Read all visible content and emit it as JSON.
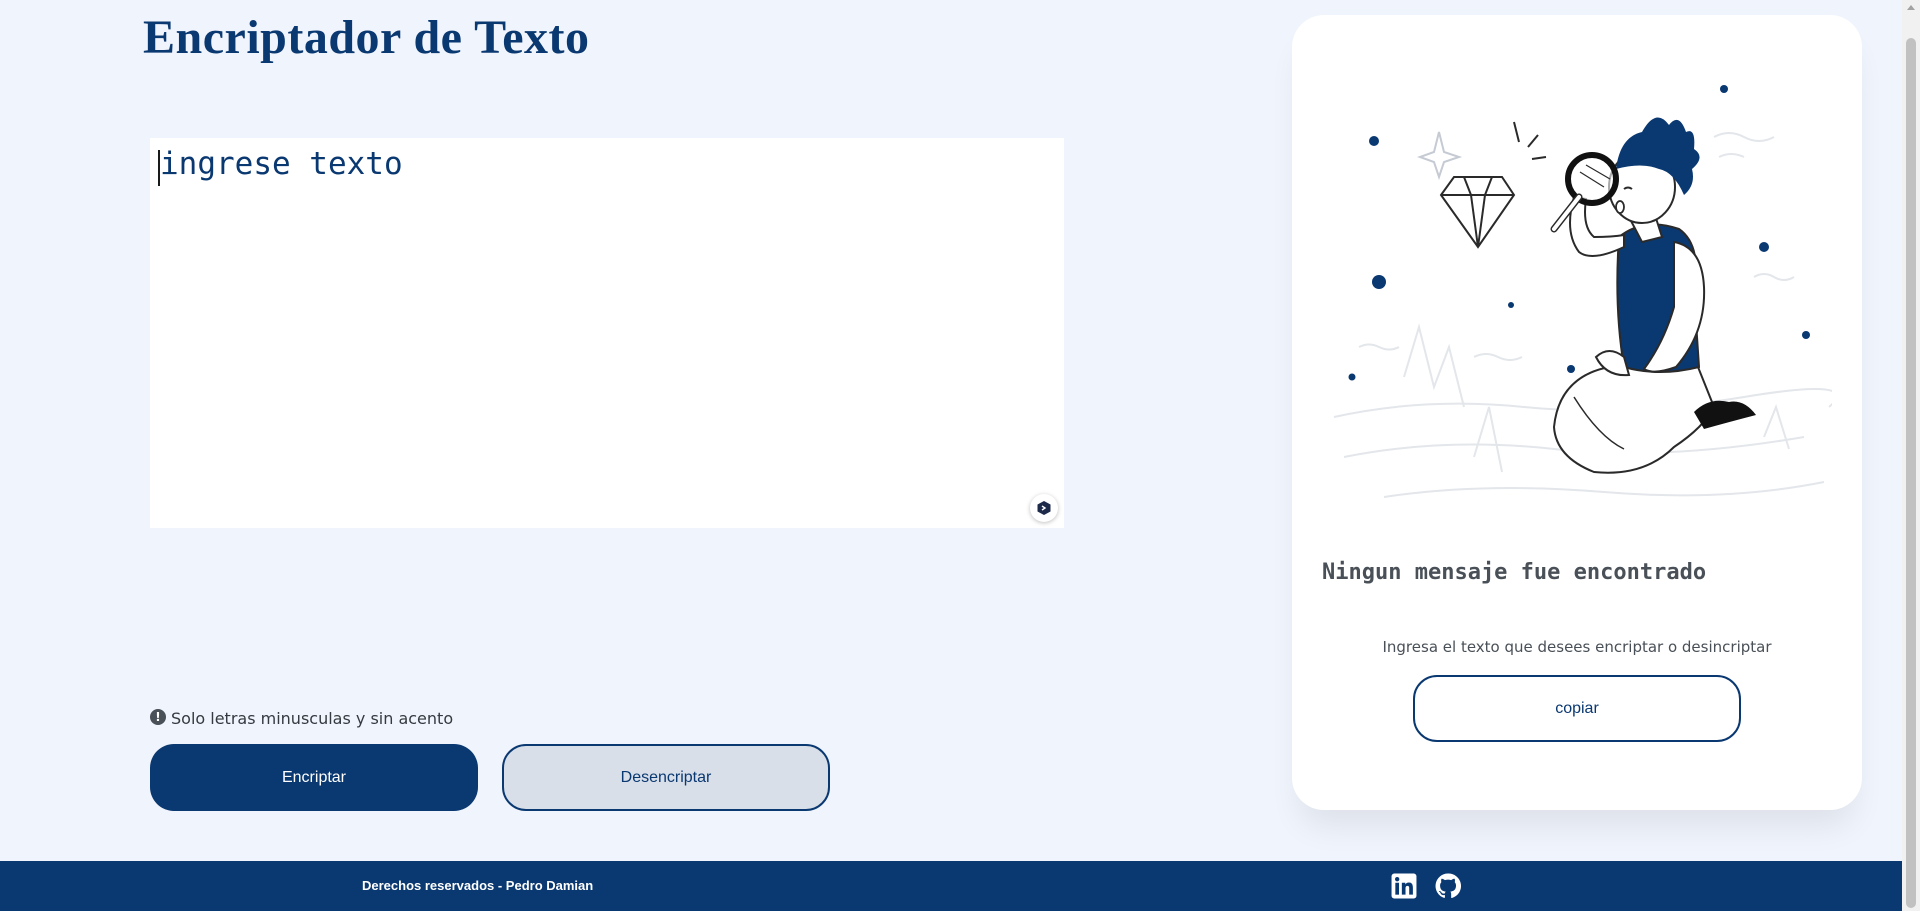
{
  "header": {
    "title": "Encriptador de Texto"
  },
  "editor": {
    "placeholder": "ingrese texto",
    "value": ""
  },
  "hint": {
    "text": "Solo letras minusculas y sin acento",
    "icon": "exclamation-circle-icon"
  },
  "actions": {
    "encrypt_label": "Encriptar",
    "decrypt_label": "Desencriptar"
  },
  "result_panel": {
    "title": "Ningun mensaje fue encontrado",
    "subtitle": "Ingresa el texto que desees encriptar o desincriptar",
    "copy_label": "copiar",
    "illustration": "person-with-magnifying-glass-illustration"
  },
  "footer": {
    "text": "Derechos reservados - Pedro Damian",
    "links": [
      {
        "icon": "linkedin-icon"
      },
      {
        "icon": "github-icon"
      }
    ]
  },
  "colors": {
    "primary": "#0a3871",
    "background": "#f0f4fc",
    "card": "#ffffff",
    "secondary_button": "#d8dfe8",
    "muted_text": "#495057"
  }
}
